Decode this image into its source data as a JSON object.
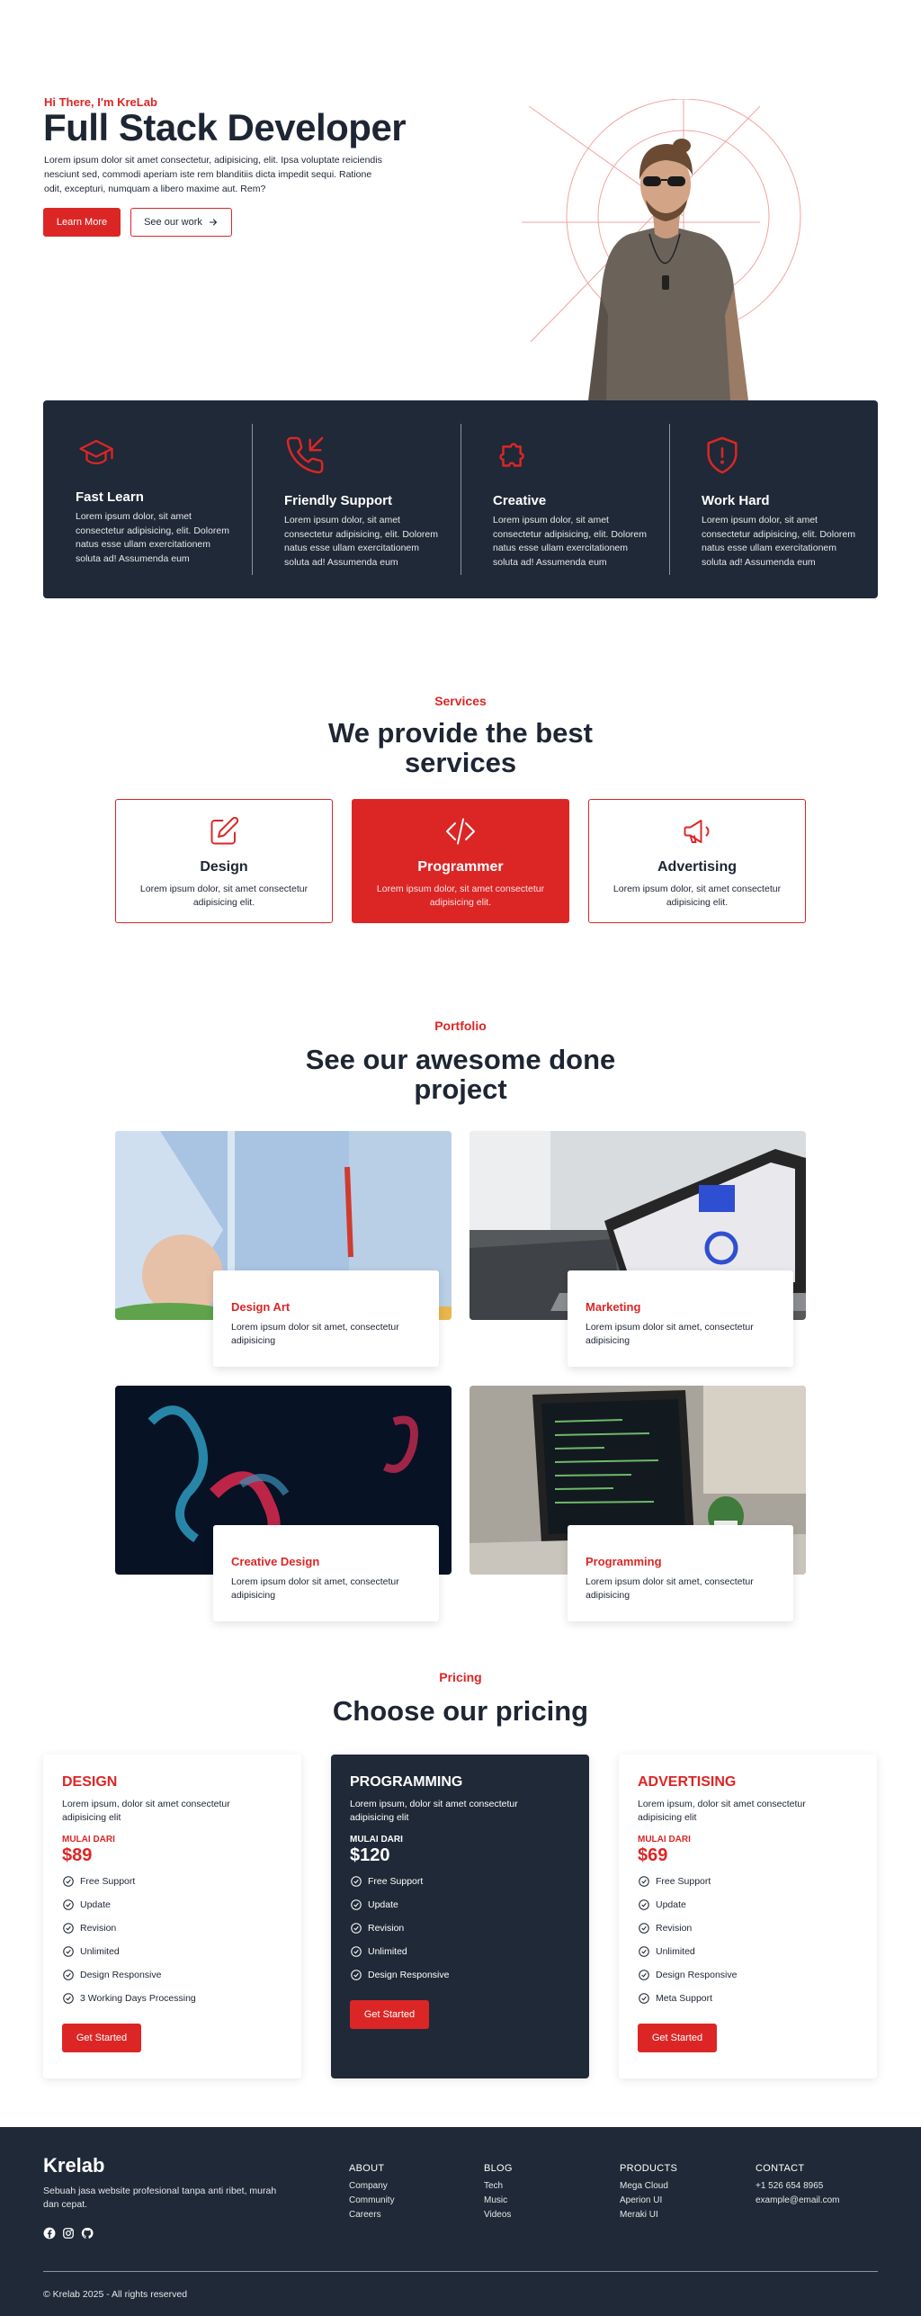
{
  "hero": {
    "kicker": "Hi There, I'm KreLab",
    "title": "Full Stack Developer",
    "description": "Lorem ipsum dolor sit amet consectetur, adipisicing, elit. Ipsa voluptate reiciendis nesciunt sed, commodi aperiam iste rem blanditiis dicta impedit sequi. Ratione odit, excepturi, numquam a libero maxime aut. Rem?",
    "learn_more": "Learn More",
    "see_work": "See our work",
    "see_work_icon": "arrow-right-icon",
    "accent": "#dc2626"
  },
  "features": [
    {
      "icon": "graduation-cap-icon",
      "title": "Fast Learn",
      "text": "Lorem ipsum dolor, sit amet consectetur adipisicing, elit. Dolorem natus esse ullam exercitationem soluta ad! Assumenda eum"
    },
    {
      "icon": "phone-icon",
      "title": "Friendly Support",
      "text": "Lorem ipsum dolor, sit amet consectetur adipisicing, elit. Dolorem natus esse ullam exercitationem soluta ad! Assumenda eum"
    },
    {
      "icon": "puzzle-icon",
      "title": "Creative",
      "text": "Lorem ipsum dolor, sit amet consectetur adipisicing, elit. Dolorem natus esse ullam exercitationem soluta ad! Assumenda eum"
    },
    {
      "icon": "shield-alert-icon",
      "title": "Work Hard",
      "text": "Lorem ipsum dolor, sit amet consectetur adipisicing, elit. Dolorem natus esse ullam exercitationem soluta ad! Assumenda eum"
    }
  ],
  "services": {
    "kicker": "Services",
    "heading": "We provide the best services",
    "items": [
      {
        "icon": "pencil-square-icon",
        "title": "Design",
        "text": "Lorem ipsum dolor, sit amet consectetur adipisicing elit."
      },
      {
        "icon": "code-icon",
        "title": "Programmer",
        "text": "Lorem ipsum dolor, sit amet consectetur adipisicing elit."
      },
      {
        "icon": "megaphone-icon",
        "title": "Advertising",
        "text": "Lorem ipsum dolor, sit amet consectetur adipisicing elit."
      }
    ]
  },
  "portfolio": {
    "kicker": "Portfolio",
    "heading": "See our awesome done project",
    "items": [
      {
        "title": "Design Art",
        "text": "Lorem ipsum dolor sit amet, consectetur adipisicing"
      },
      {
        "title": "Marketing",
        "text": "Lorem ipsum dolor sit amet, consectetur adipisicing"
      },
      {
        "title": "Creative Design",
        "text": "Lorem ipsum dolor sit amet, consectetur adipisicing"
      },
      {
        "title": "Programming",
        "text": "Lorem ipsum dolor sit amet, consectetur adipisicing"
      }
    ]
  },
  "pricing": {
    "kicker": "Pricing",
    "heading": "Choose our pricing",
    "plans": [
      {
        "name": "DESIGN",
        "desc": "Lorem ipsum, dolor sit amet consectetur adipisicing elit",
        "from": "MULAI DARI",
        "price": "$89",
        "features": [
          "Free Support",
          "Update",
          "Revision",
          "Unlimited",
          "Design Responsive",
          "3 Working Days Processing"
        ],
        "cta": "Get Started"
      },
      {
        "name": "PROGRAMMING",
        "desc": "Lorem ipsum, dolor sit amet consectetur adipisicing elit",
        "from": "MULAI DARI",
        "price": "$120",
        "features": [
          "Free Support",
          "Update",
          "Revision",
          "Unlimited",
          "Design Responsive"
        ],
        "cta": "Get Started"
      },
      {
        "name": "ADVERTISING",
        "desc": "Lorem ipsum, dolor sit amet consectetur adipisicing elit",
        "from": "MULAI DARI",
        "price": "$69",
        "features": [
          "Free Support",
          "Update",
          "Revision",
          "Unlimited",
          "Design Responsive",
          "Meta Support"
        ],
        "cta": "Get Started"
      }
    ]
  },
  "footer": {
    "brand": "Krelab",
    "tagline": "Sebuah jasa website profesional tanpa anti ribet, murah dan cepat.",
    "social": [
      "facebook-icon",
      "instagram-icon",
      "github-icon"
    ],
    "columns": [
      {
        "title": "ABOUT",
        "links": [
          "Company",
          "Community",
          "Careers"
        ]
      },
      {
        "title": "BLOG",
        "links": [
          "Tech",
          "Music",
          "Videos"
        ]
      },
      {
        "title": "PRODUCTS",
        "links": [
          "Mega Cloud",
          "Aperion UI",
          "Meraki UI"
        ]
      },
      {
        "title": "CONTACT",
        "links": [
          "+1 526 654 8965",
          "example@email.com"
        ]
      }
    ],
    "copyright": "© Krelab 2025 - All rights reserved"
  }
}
